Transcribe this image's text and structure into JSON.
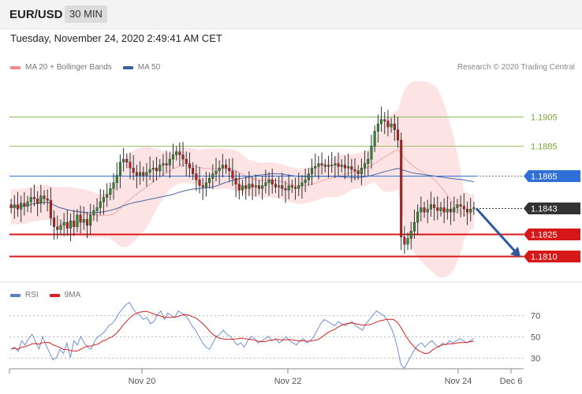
{
  "header": {
    "symbol": "EUR/USD",
    "interval": "30 MIN",
    "datetime": "Tuesday, November 24, 2020 2:49:41 AM CET"
  },
  "legend": {
    "items": [
      {
        "label": "MA 20 + Bollinger Bands",
        "color": "#f08c8c"
      },
      {
        "label": "MA 50",
        "color": "#3a5f9a"
      }
    ],
    "credit": "Research © 2020 Trading Central"
  },
  "rsi_legend": {
    "items": [
      {
        "label": "RSI",
        "color": "#5a7fd0"
      },
      {
        "label": "9MA",
        "color": "#d42020"
      }
    ]
  },
  "chart_data": {
    "type": "candlestick",
    "price_axis_range": [
      1.179,
      1.192
    ],
    "levels": [
      {
        "price": 1.1905,
        "label": "1.1905",
        "kind": "resistance",
        "color": "#8bbd5a"
      },
      {
        "price": 1.1885,
        "label": "1.1885",
        "kind": "resistance",
        "color": "#9cc26a"
      },
      {
        "price": 1.1865,
        "label": "1.1865",
        "kind": "pivot",
        "color": "#2f6fd8"
      },
      {
        "price": 1.1843,
        "label": "1.1843",
        "kind": "last",
        "color": "#333333"
      },
      {
        "price": 1.1825,
        "label": "1.1825",
        "kind": "support",
        "color": "#d81818"
      },
      {
        "price": 1.181,
        "label": "1.1810",
        "kind": "support",
        "color": "#d81818"
      }
    ],
    "x_ticks": [
      "Nov 20",
      "Nov 22",
      "Nov 24",
      "Dec 6"
    ],
    "closes": [
      1.1843,
      1.1845,
      1.1842,
      1.1846,
      1.1844,
      1.1847,
      1.185,
      1.1849,
      1.1846,
      1.1851,
      1.1849,
      1.1848,
      1.1836,
      1.183,
      1.1828,
      1.1831,
      1.1833,
      1.1829,
      1.1834,
      1.183,
      1.1838,
      1.1833,
      1.1835,
      1.1831,
      1.1838,
      1.1841,
      1.1843,
      1.1847,
      1.185,
      1.1852,
      1.1856,
      1.186,
      1.1865,
      1.1874,
      1.1876,
      1.1874,
      1.187,
      1.1867,
      1.1865,
      1.1867,
      1.1865,
      1.1867,
      1.1869,
      1.187,
      1.1868,
      1.1872,
      1.1873,
      1.1872,
      1.1876,
      1.1879,
      1.1881,
      1.1879,
      1.1876,
      1.1873,
      1.187,
      1.1866,
      1.1862,
      1.1858,
      1.1857,
      1.186,
      1.1863,
      1.1866,
      1.1868,
      1.187,
      1.1872,
      1.187,
      1.1868,
      1.1863,
      1.1859,
      1.1855,
      1.1858,
      1.1856,
      1.1859,
      1.1857,
      1.1858,
      1.1856,
      1.1858,
      1.186,
      1.1862,
      1.1859,
      1.1857,
      1.1858,
      1.1856,
      1.1855,
      1.1858,
      1.1857,
      1.1856,
      1.1858,
      1.186,
      1.1862,
      1.1866,
      1.187,
      1.1871,
      1.1873,
      1.1872,
      1.1871,
      1.1872,
      1.1872,
      1.1873,
      1.1871,
      1.1872,
      1.187,
      1.1871,
      1.1869,
      1.1868,
      1.1866,
      1.187,
      1.1873,
      1.1876,
      1.1885,
      1.1895,
      1.19,
      1.1903,
      1.1902,
      1.1898,
      1.19,
      1.1896,
      1.1889,
      1.1823,
      1.1818,
      1.1822,
      1.1827,
      1.1833,
      1.184,
      1.1843,
      1.184,
      1.1842,
      1.1845,
      1.1843,
      1.1841,
      1.1843,
      1.184,
      1.1842,
      1.184,
      1.1843,
      1.1845,
      1.1844,
      1.1842,
      1.184,
      1.1842,
      1.1843
    ],
    "rsi_axis": [
      30,
      50,
      70
    ],
    "rsi": [
      38,
      40,
      36,
      46,
      42,
      48,
      52,
      45,
      38,
      50,
      42,
      35,
      28,
      30,
      38,
      34,
      44,
      30,
      46,
      42,
      50,
      44,
      40,
      38,
      46,
      50,
      52,
      55,
      60,
      62,
      66,
      72,
      76,
      80,
      82,
      76,
      72,
      70,
      66,
      68,
      62,
      64,
      70,
      74,
      66,
      72,
      70,
      68,
      74,
      72,
      70,
      66,
      60,
      56,
      50,
      44,
      40,
      38,
      44,
      50,
      52,
      56,
      52,
      50,
      46,
      42,
      44,
      40,
      46,
      50,
      48,
      44,
      46,
      48,
      50,
      46,
      48,
      44,
      46,
      50,
      46,
      44,
      42,
      46,
      48,
      44,
      46,
      50,
      56,
      62,
      66,
      64,
      62,
      60,
      64,
      62,
      60,
      62,
      64,
      60,
      58,
      56,
      62,
      66,
      70,
      74,
      72,
      70,
      66,
      60,
      52,
      40,
      24,
      20,
      26,
      32,
      38,
      42,
      44,
      40,
      44,
      46,
      42,
      40,
      44,
      42,
      46,
      44,
      46,
      48,
      46,
      44,
      46,
      48
    ]
  }
}
